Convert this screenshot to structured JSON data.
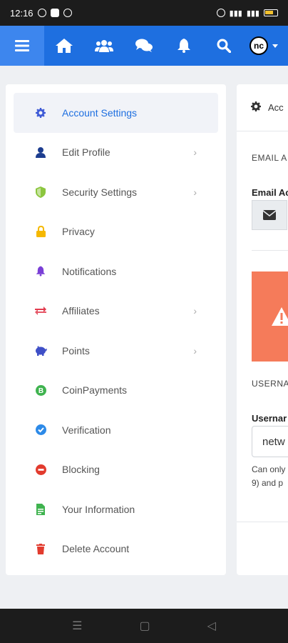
{
  "status_bar": {
    "time": "12:16"
  },
  "topnav": {
    "avatar_initials": "nc"
  },
  "sidebar": {
    "items": [
      {
        "label": "Account Settings",
        "icon": "gear-icon",
        "color": "#3f5bd6",
        "active": true,
        "chevron": false
      },
      {
        "label": "Edit Profile",
        "icon": "user-icon",
        "color": "#1d3d8f",
        "chevron": true
      },
      {
        "label": "Security Settings",
        "icon": "shield-icon",
        "color": "#8cc63f",
        "chevron": true
      },
      {
        "label": "Privacy",
        "icon": "lock-icon",
        "color": "#f5b800",
        "chevron": false
      },
      {
        "label": "Notifications",
        "icon": "bell-icon",
        "color": "#7a3fd6",
        "chevron": false
      },
      {
        "label": "Affiliates",
        "icon": "exchange-icon",
        "color": "#e23b4e",
        "chevron": true
      },
      {
        "label": "Points",
        "icon": "piggy-bank-icon",
        "color": "#3f4fc7",
        "chevron": true
      },
      {
        "label": "CoinPayments",
        "icon": "bitcoin-icon",
        "color": "#3fb34f",
        "chevron": false
      },
      {
        "label": "Verification",
        "icon": "check-badge-icon",
        "color": "#2d8ae8",
        "chevron": false
      },
      {
        "label": "Blocking",
        "icon": "block-icon",
        "color": "#e23b2e",
        "chevron": false
      },
      {
        "label": "Your Information",
        "icon": "document-icon",
        "color": "#3fb34f",
        "chevron": false
      },
      {
        "label": "Delete Account",
        "icon": "trash-icon",
        "color": "#e23b2e",
        "chevron": false
      }
    ]
  },
  "right_panel": {
    "header": "Acc",
    "email_section_label": "EMAIL A",
    "email_field_label": "Email Ac",
    "username_section_label": "USERNA",
    "username_field_label": "Usernar",
    "username_value": "netw",
    "help_text_line1": "Can only",
    "help_text_line2": "9) and p"
  }
}
